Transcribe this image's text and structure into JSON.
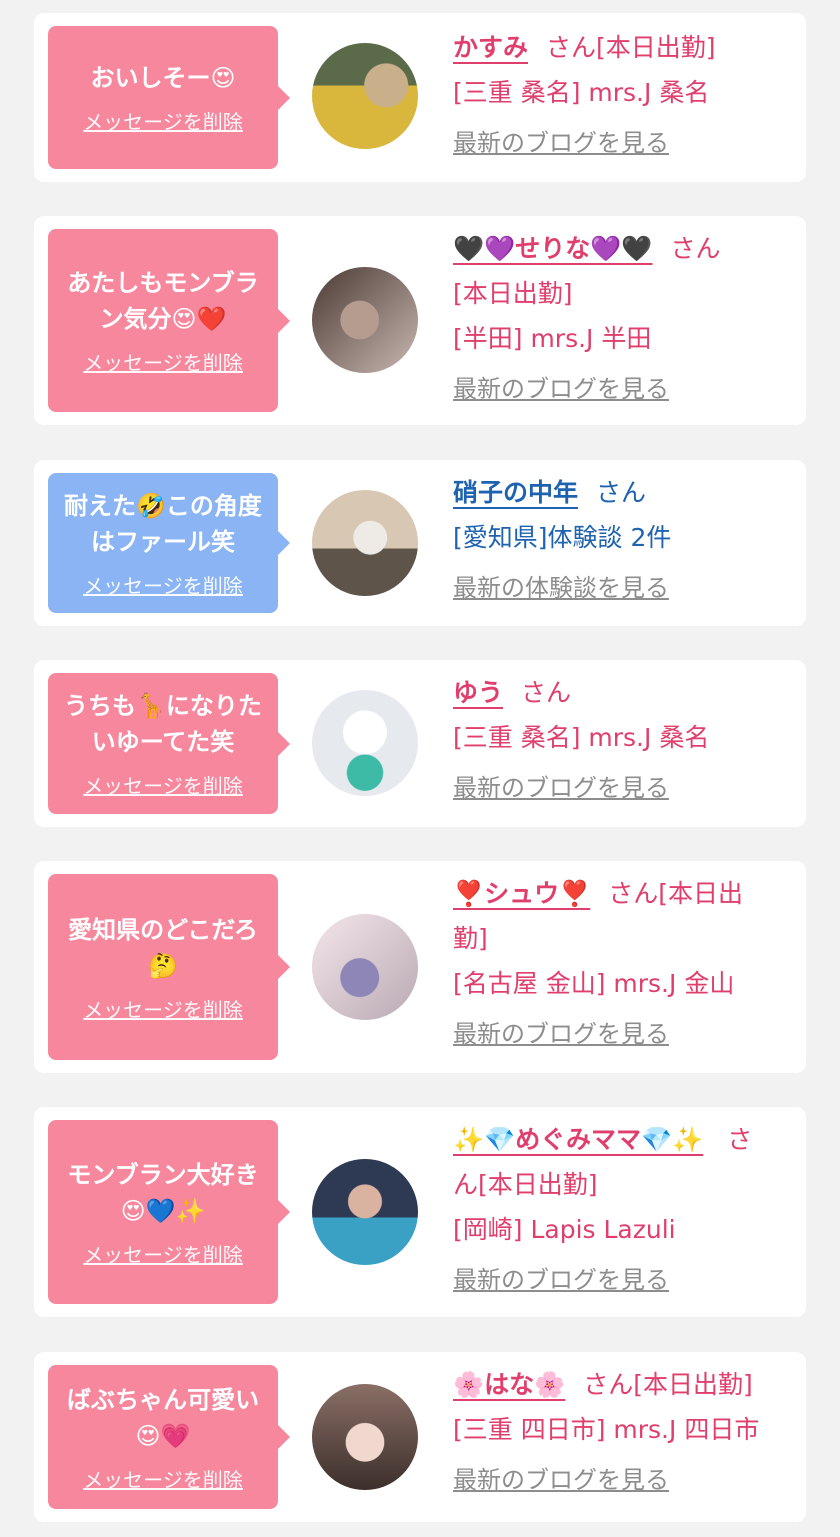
{
  "delete_label": "メッセージを削除",
  "san": "さん",
  "cards": [
    {
      "bubble_color": "pink",
      "message": "おいしそー😍",
      "name": "かすみ",
      "san_line": "[本日出勤]",
      "line2": "",
      "line3": "[三重 桑名] mrs.J 桑名",
      "latest": "最新のブログを見る",
      "name_color": "pink",
      "avatar_colors": [
        "#d9b73c",
        "#3f4b3a"
      ]
    },
    {
      "bubble_color": "pink",
      "message": "あたしもモンブラン気分😍❤️",
      "name": "🖤💜せりな💜🖤",
      "san_line": "",
      "line2": "[本日出勤]",
      "line3": "[半田] mrs.J 半田",
      "latest": "最新のブログを見る",
      "name_color": "pink",
      "avatar_colors": [
        "#6a5a52",
        "#c9b8b2"
      ]
    },
    {
      "bubble_color": "blue",
      "message": "耐えた🤣この角度はファール笑",
      "name": "硝子の中年",
      "san_line": "",
      "line2": "",
      "line3": "[愛知県]体験談 2件",
      "latest": "最新の体験談を見る",
      "name_color": "blue",
      "avatar_colors": [
        "#d8c7b3",
        "#5e544a"
      ]
    },
    {
      "bubble_color": "pink",
      "message": "うちも🦒になりたいゆーてた笑",
      "name": "ゆう",
      "san_line": "",
      "line2": "",
      "line3": "[三重 桑名] mrs.J 桑名",
      "latest": "最新のブログを見る",
      "name_color": "pink",
      "avatar_colors": [
        "#eef2f4",
        "#3dbba6"
      ]
    },
    {
      "bubble_color": "pink",
      "message": "愛知県のどこだろ🤔",
      "name": "❣️シュウ❣️",
      "san_line": "[本日出",
      "line2": "勤]",
      "line3": "[名古屋 金山] mrs.J 金山",
      "latest": "最新のブログを見る",
      "name_color": "pink",
      "avatar_colors": [
        "#eadde2",
        "#8d86b6"
      ]
    },
    {
      "bubble_color": "pink",
      "message": "モンブラン大好き😍💙✨",
      "name": "✨💎めぐみママ💎✨",
      "san_line": "",
      "line2": "ん[本日出勤]",
      "line3": "[岡崎] Lapis Lazuli",
      "latest": "最新のブログを見る",
      "name_color": "pink",
      "avatar_colors": [
        "#2e3a54",
        "#c9a08d"
      ]
    },
    {
      "bubble_color": "pink",
      "message": "ばぶちゃん可愛い😍💗",
      "name": "🌸はな🌸",
      "san_line": "[本日出勤]",
      "line2": "",
      "line3": "[三重 四日市] mrs.J 四日市",
      "latest": "最新のブログを見る",
      "name_color": "pink",
      "avatar_colors": [
        "#b08a7c",
        "#f0d8cf"
      ]
    }
  ]
}
